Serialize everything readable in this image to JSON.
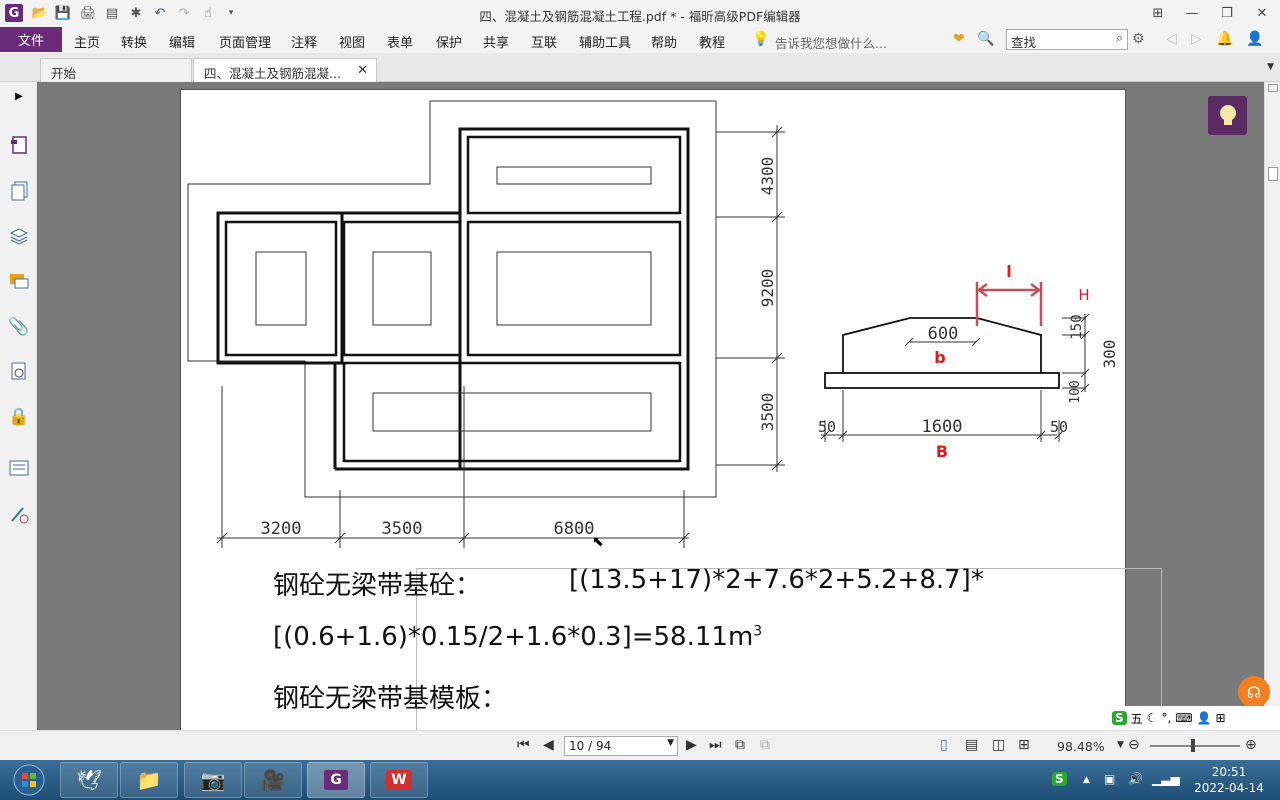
{
  "window": {
    "title": "四、混凝土及钢筋混凝土工程.pdf * - 福昕高级PDF编辑器"
  },
  "menu": {
    "file": "文件",
    "items": [
      "主页",
      "转换",
      "编辑",
      "页面管理",
      "注释",
      "视图",
      "表单",
      "保护",
      "共享",
      "互联",
      "辅助工具",
      "帮助",
      "教程"
    ],
    "tell_me": "告诉我您想做什么...",
    "search_placeholder": "查找"
  },
  "tabs": [
    {
      "label": "开始"
    },
    {
      "label": "四、混凝土及钢筋混凝..."
    }
  ],
  "drawing": {
    "plan_right_dims": [
      "4300",
      "9200",
      "3500"
    ],
    "plan_bottom_dims": [
      "3200",
      "3500",
      "6800"
    ],
    "section": {
      "top_width": "600",
      "base_width": "1600",
      "edge_left": "50",
      "edge_right": "50",
      "height_top": "150",
      "height_total": "300",
      "height_base": "100",
      "label_b": "b",
      "label_B": "B",
      "label_H": "H",
      "label_l": "l"
    }
  },
  "calc": {
    "line1_label": "钢砼无梁带基砼：",
    "line1_formula": "[(13.5+17)*2+7.6*2+5.2+8.7]*",
    "line2_formula": "[(0.6+1.6)*0.15/2+1.6*0.3]=58.11m",
    "line2_sup": "3",
    "line3_label": "钢砼无梁带基模板："
  },
  "status": {
    "page_indicator": "10 / 94",
    "zoom": "98.48%"
  },
  "ime": {
    "mode": "五"
  },
  "taskbar": {
    "time": "20:51",
    "date": "2022-04-14"
  }
}
